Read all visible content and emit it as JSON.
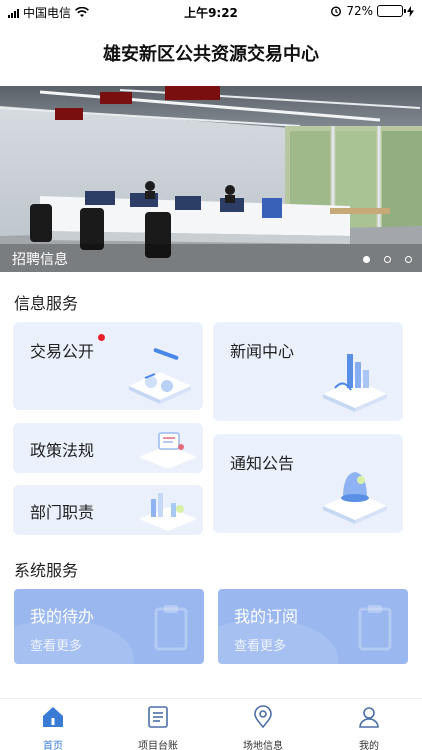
{
  "status_bar": {
    "carrier": "中国电信",
    "time": "上午9:22",
    "battery": "72%",
    "battery_level": 0.72
  },
  "header": {
    "title": "雄安新区公共资源交易中心"
  },
  "banner": {
    "caption": "招聘信息",
    "slide_count": 3,
    "active_slide": 1
  },
  "info_services": {
    "title": "信息服务",
    "items": [
      {
        "label": "交易公开",
        "has_badge": true
      },
      {
        "label": "新闻中心"
      },
      {
        "label": "政策法规"
      },
      {
        "label": "通知公告"
      },
      {
        "label": "部门职责"
      }
    ]
  },
  "system_services": {
    "title": "系统服务",
    "items": [
      {
        "title": "我的待办",
        "subtitle": "查看更多"
      },
      {
        "title": "我的订阅",
        "subtitle": "查看更多"
      }
    ]
  },
  "tab_bar": {
    "items": [
      {
        "label": "首页",
        "icon": "home-icon",
        "active": true
      },
      {
        "label": "项目台账",
        "icon": "document-icon"
      },
      {
        "label": "场地信息",
        "icon": "location-pin-icon"
      },
      {
        "label": "我的",
        "icon": "user-icon"
      }
    ]
  },
  "colors": {
    "accent": "#3a7bd5",
    "card_bg": "#eaf1fc",
    "sys_card_bg": "#9ab8ef",
    "badge": "#e8202e"
  }
}
